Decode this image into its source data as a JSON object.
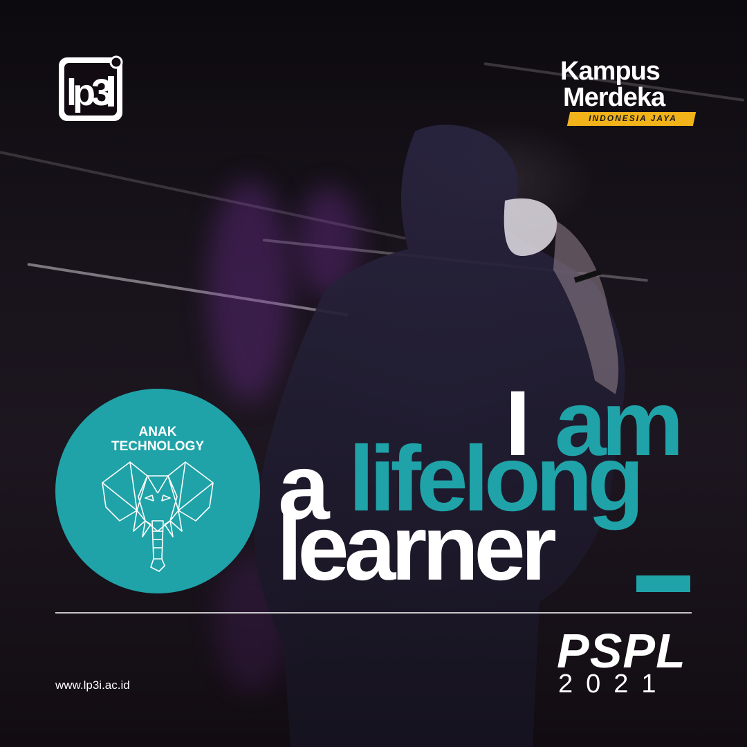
{
  "brand": {
    "teal": "#1fa3a8",
    "white": "#ffffff",
    "yellow": "#f2b21a"
  },
  "logos": {
    "lp3i": "LP3I logo",
    "kampus_merdeka": {
      "line1": "Kampus",
      "line2": "Merdeka",
      "tagline": "INDONESIA JAYA"
    }
  },
  "badge": {
    "line1": "ANAK",
    "line2": "TECHNOLOGY",
    "icon": "elephant-icon"
  },
  "slogan": {
    "w1": "I",
    "w2": "am",
    "w3": "a",
    "w4": "lifelong",
    "w5": "learner"
  },
  "footer": {
    "website": "www.lp3i.ac.id",
    "program": "PSPL",
    "year": "2021"
  }
}
